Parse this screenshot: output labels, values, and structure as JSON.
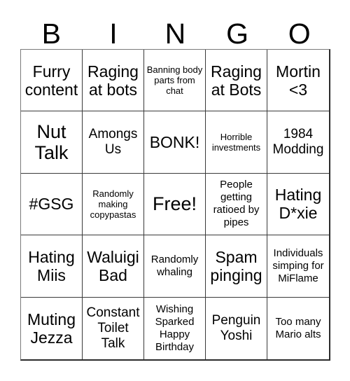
{
  "card": {
    "title": "BINGO",
    "header_letters": [
      "B",
      "I",
      "N",
      "G",
      "O"
    ],
    "rows": 5,
    "columns": 5,
    "free_space_label": "Free!",
    "colors": {
      "background": "#ffffff",
      "text": "#000000",
      "grid_line": "#3a3a3a",
      "grid_outer": "#2b2b2b"
    },
    "cells": [
      [
        {
          "text": "Furry content",
          "size": "lg"
        },
        {
          "text": "Raging at bots",
          "size": "lg"
        },
        {
          "text": "Banning body parts from chat",
          "size": "xs"
        },
        {
          "text": "Raging at Bots",
          "size": "lg"
        },
        {
          "text": "Mortin <3",
          "size": "lg"
        }
      ],
      [
        {
          "text": "Nut Talk",
          "size": "xl"
        },
        {
          "text": "Amongs Us",
          "size": "md"
        },
        {
          "text": "BONK!",
          "size": "lg"
        },
        {
          "text": "Horrible investments",
          "size": "xs"
        },
        {
          "text": "1984 Modding",
          "size": "md"
        }
      ],
      [
        {
          "text": "#GSG",
          "size": "lg"
        },
        {
          "text": "Randomly making copypastas",
          "size": "xs"
        },
        {
          "text": "Free!",
          "size": "xl"
        },
        {
          "text": "People getting ratioed by pipes",
          "size": "sm"
        },
        {
          "text": "Hating D*xie",
          "size": "lg"
        }
      ],
      [
        {
          "text": "Hating Miis",
          "size": "lg"
        },
        {
          "text": "Waluigi Bad",
          "size": "lg"
        },
        {
          "text": "Randomly whaling",
          "size": "sm"
        },
        {
          "text": "Spam pinging",
          "size": "lg"
        },
        {
          "text": "Individuals simping for MiFlame",
          "size": "sm"
        }
      ],
      [
        {
          "text": "Muting Jezza",
          "size": "lg"
        },
        {
          "text": "Constant Toilet Talk",
          "size": "md"
        },
        {
          "text": "Wishing Sparked Happy Birthday",
          "size": "sm"
        },
        {
          "text": "Penguin Yoshi",
          "size": "md"
        },
        {
          "text": "Too many Mario alts",
          "size": "sm"
        }
      ]
    ]
  }
}
